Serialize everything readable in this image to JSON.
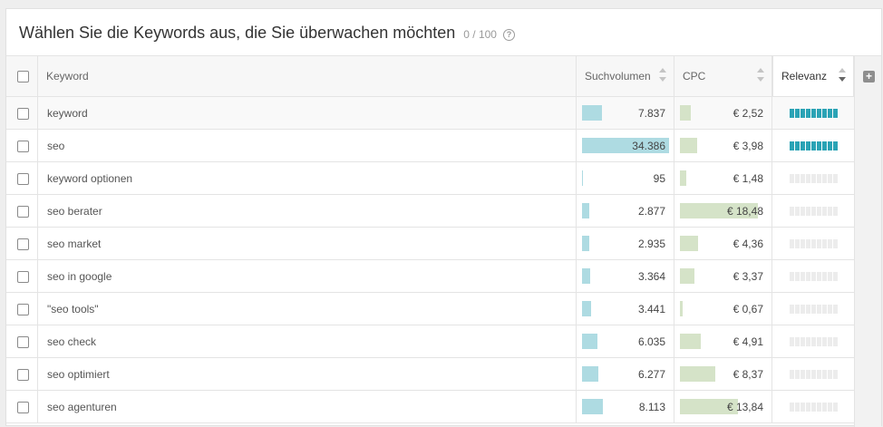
{
  "header": {
    "title": "Wählen Sie die Keywords aus, die Sie überwachen möchten",
    "counter": "0 / 100",
    "help_icon": "?"
  },
  "columns": {
    "keyword": "Keyword",
    "volume": "Suchvolumen",
    "cpc": "CPC",
    "relevance": "Relevanz",
    "add_icon": "+"
  },
  "colors": {
    "volume_bar": "#aedbe2",
    "cpc_bar": "#d5e3c8",
    "relevance_high": "#2aa3b5",
    "relevance_low": "#ececec"
  },
  "rows": [
    {
      "keyword": "keyword",
      "volume": "7.837",
      "volume_value": 7837,
      "cpc": "€ 2,52",
      "cpc_value": 2.52,
      "relevance": "high"
    },
    {
      "keyword": "seo",
      "volume": "34.386",
      "volume_value": 34386,
      "cpc": "€ 3,98",
      "cpc_value": 3.98,
      "relevance": "high"
    },
    {
      "keyword": "keyword optionen",
      "volume": "95",
      "volume_value": 95,
      "cpc": "€ 1,48",
      "cpc_value": 1.48,
      "relevance": "low"
    },
    {
      "keyword": "seo berater",
      "volume": "2.877",
      "volume_value": 2877,
      "cpc": "€ 18,48",
      "cpc_value": 18.48,
      "relevance": "low"
    },
    {
      "keyword": "seo market",
      "volume": "2.935",
      "volume_value": 2935,
      "cpc": "€ 4,36",
      "cpc_value": 4.36,
      "relevance": "low"
    },
    {
      "keyword": "seo in google",
      "volume": "3.364",
      "volume_value": 3364,
      "cpc": "€ 3,37",
      "cpc_value": 3.37,
      "relevance": "low"
    },
    {
      "keyword": "\"seo tools\"",
      "volume": "3.441",
      "volume_value": 3441,
      "cpc": "€ 0,67",
      "cpc_value": 0.67,
      "relevance": "low"
    },
    {
      "keyword": "seo check",
      "volume": "6.035",
      "volume_value": 6035,
      "cpc": "€ 4,91",
      "cpc_value": 4.91,
      "relevance": "low"
    },
    {
      "keyword": "seo optimiert",
      "volume": "6.277",
      "volume_value": 6277,
      "cpc": "€ 8,37",
      "cpc_value": 8.37,
      "relevance": "low"
    },
    {
      "keyword": "seo agenturen",
      "volume": "8.113",
      "volume_value": 8113,
      "cpc": "€ 13,84",
      "cpc_value": 13.84,
      "relevance": "low"
    }
  ]
}
